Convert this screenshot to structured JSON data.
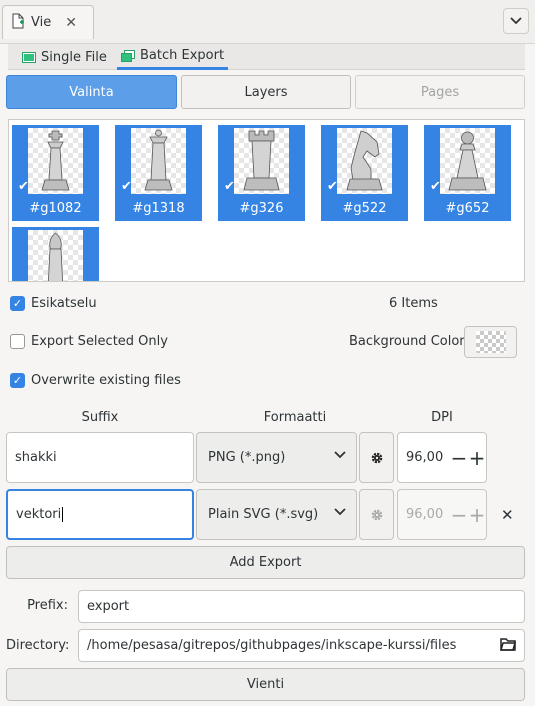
{
  "dock": {
    "tab_label": "Vie",
    "accent": "#3584e4"
  },
  "mode_tabs": [
    {
      "label": "Single File",
      "icon": "single-file-icon",
      "active": false
    },
    {
      "label": "Batch Export",
      "icon": "batch-export-icon",
      "active": true
    }
  ],
  "selection_tabs": [
    {
      "label": "Valinta",
      "active": true
    },
    {
      "label": "Layers",
      "active": false
    },
    {
      "label": "Pages",
      "active": false,
      "disabled": true
    }
  ],
  "preview_items": [
    {
      "name": "#g1082",
      "piece": "king",
      "checked": true
    },
    {
      "name": "#g1318",
      "piece": "queen",
      "checked": true
    },
    {
      "name": "#g326",
      "piece": "rook",
      "checked": true
    },
    {
      "name": "#g522",
      "piece": "knight",
      "checked": true
    },
    {
      "name": "#g652",
      "piece": "pawn",
      "checked": true
    },
    {
      "name": "",
      "piece": "bishop",
      "checked": true
    }
  ],
  "options": {
    "preview_label": "Esikatselu",
    "preview_checked": true,
    "items_count": "6 Items",
    "export_selected_label": "Export Selected Only",
    "export_selected_checked": false,
    "background_color_label": "Background Color",
    "overwrite_label": "Overwrite existing files",
    "overwrite_checked": true
  },
  "columns": {
    "suffix": "Suffix",
    "format": "Formaatti",
    "dpi": "DPI"
  },
  "exports": [
    {
      "suffix": "shakki",
      "format": "PNG (*.png)",
      "dpi": "96,00",
      "dpi_enabled": true
    },
    {
      "suffix": "vektori",
      "format": "Plain SVG (*.svg)",
      "dpi": "96,00",
      "dpi_enabled": false
    }
  ],
  "add_export_label": "Add Export",
  "prefix": {
    "label": "Prefix:",
    "value": "export"
  },
  "directory": {
    "label": "Directory:",
    "value": "/home/pesasa/gitrepos/githubpages/inkscape-kurssi/files"
  },
  "export_button_label": "Vienti"
}
